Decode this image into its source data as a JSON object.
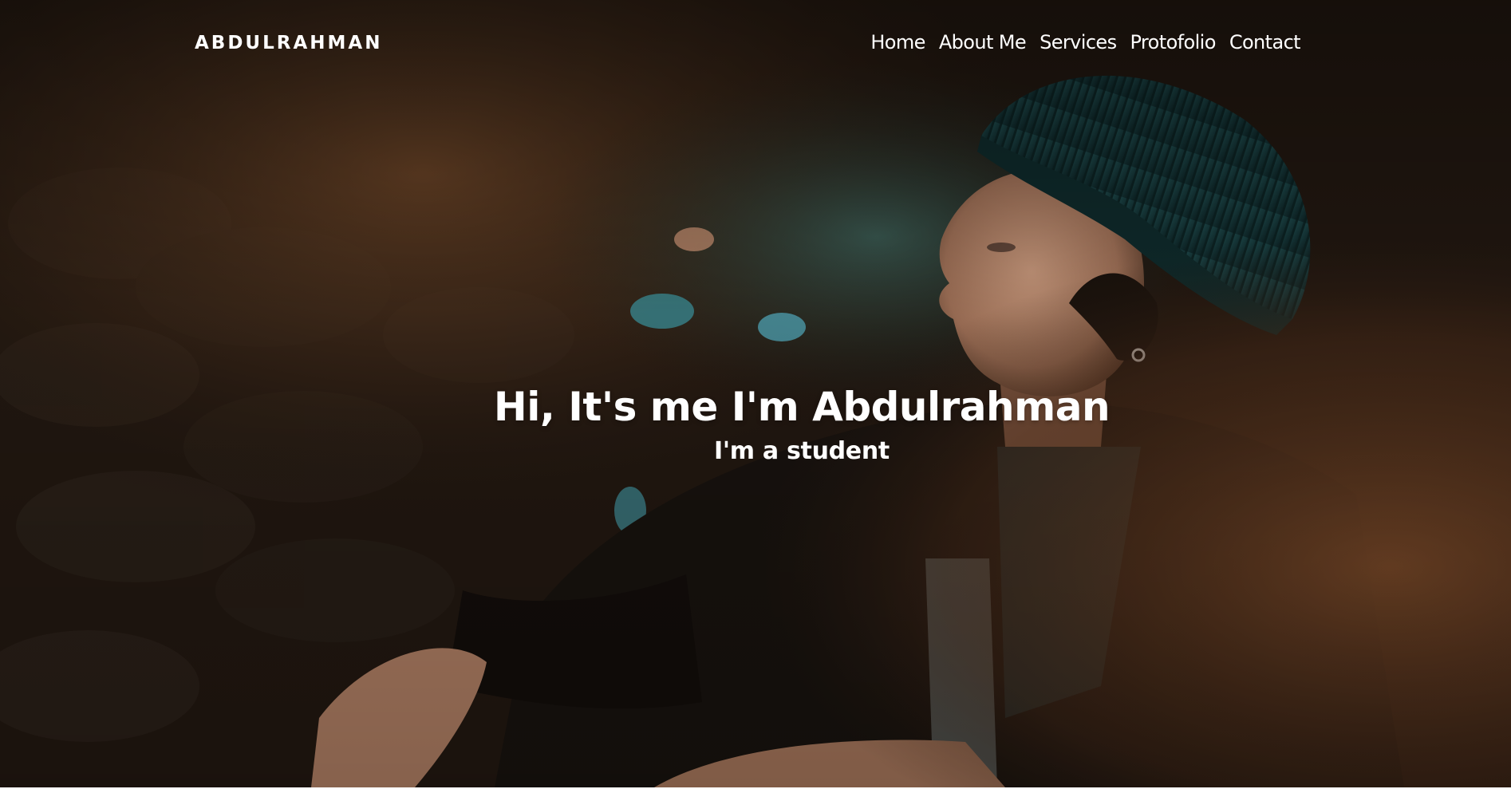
{
  "navbar": {
    "logo": "ABDULRAHMAN",
    "links": [
      {
        "label": "Home"
      },
      {
        "label": "About Me"
      },
      {
        "label": "Services"
      },
      {
        "label": "Protofolio"
      },
      {
        "label": "Contact"
      }
    ]
  },
  "hero": {
    "title": "Hi, It's me I'm Abdulrahman",
    "subtitle": "I'm a student",
    "photo_icon": "person-in-beanie-photo",
    "colors": {
      "text": "#ffffff",
      "overlay": "#231912",
      "beanie": "#14383a",
      "skin": "#b9866a"
    }
  }
}
